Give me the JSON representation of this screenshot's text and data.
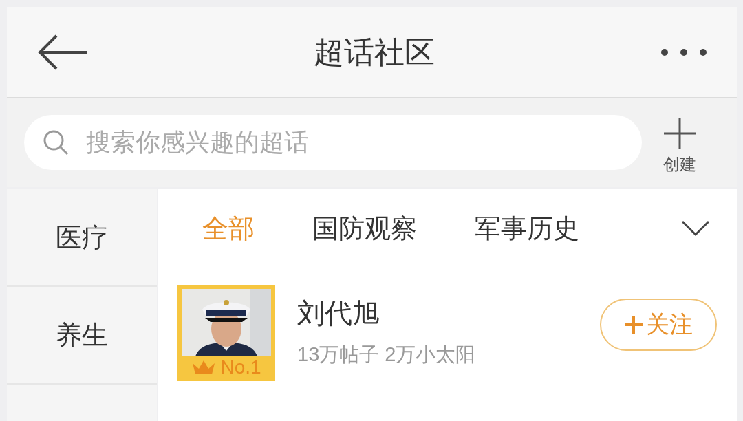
{
  "header": {
    "title": "超话社区"
  },
  "search": {
    "placeholder": "搜索你感兴趣的超话"
  },
  "create_button": {
    "label": "创建"
  },
  "sidebar": {
    "items": [
      {
        "label": "医疗"
      },
      {
        "label": "养生"
      }
    ]
  },
  "tabs": [
    {
      "label": "全部",
      "selected": true
    },
    {
      "label": "国防观察",
      "selected": false
    },
    {
      "label": "军事历史",
      "selected": false
    }
  ],
  "topics": [
    {
      "name": "刘代旭",
      "stats": "13万帖子 2万小太阳",
      "rank": "No.1",
      "follow_label": "关注"
    }
  ]
}
